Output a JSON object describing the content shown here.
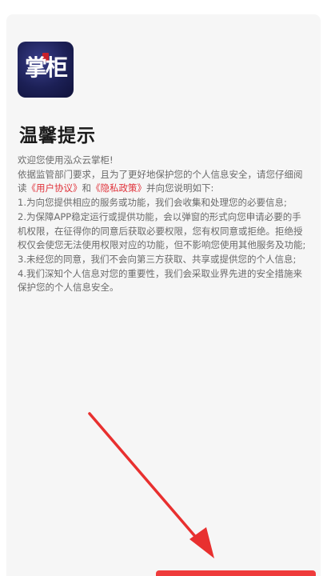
{
  "app": {
    "logo_text": "掌柜"
  },
  "dialog": {
    "title": "温馨提示",
    "greeting": "欢迎您使用泓众云掌柜!",
    "intro_before": "依据监管部门要求，且为了更好地保护您的个人信息安全，请您仔细阅读",
    "user_agreement_link": "《用户协议》",
    "and_text": "和",
    "privacy_policy_link": "《隐私政策》",
    "intro_after": "并向您说明如下:",
    "items": [
      "1.为向您提供相应的服务或功能，我们会收集和处理您的必要信息;",
      "2.为保障APP稳定运行或提供功能，会以弹窗的形式向您申请必要的手机权限，在征得你的同意后获取必要权限，您有权同意或拒绝。拒绝授权仅会使您无法使用权限对应的功能，但不影响您使用其他服务及功能;",
      "3.未经您的同意，我们不会向第三方获取、共享或提供您的个人信息;",
      "4.我们深知个人信息对您的重要性，我们会采取业界先进的安全措施来保护您的个人信息安全。"
    ]
  },
  "colors": {
    "link": "#e0323a",
    "arrow": "#e8302f",
    "card_background": "#f6f6f6"
  }
}
